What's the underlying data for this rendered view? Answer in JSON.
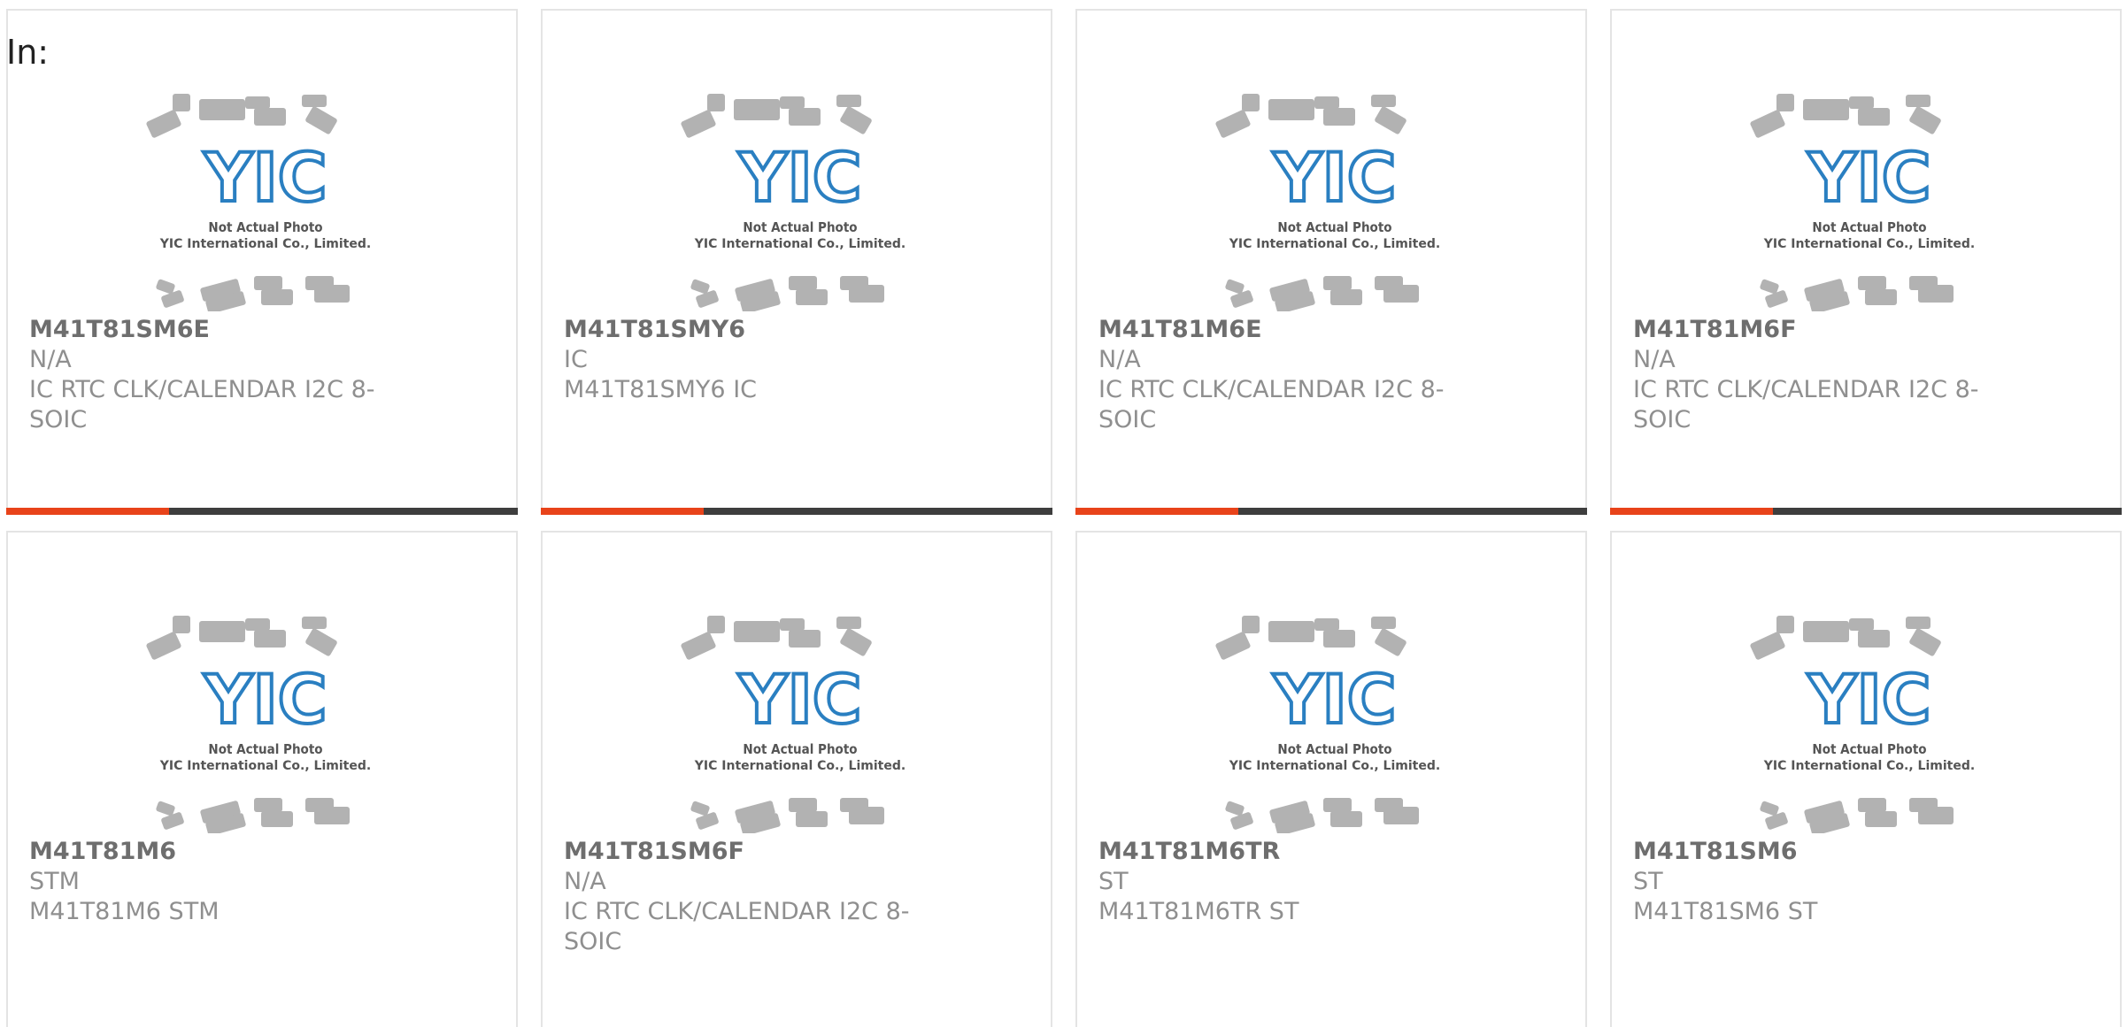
{
  "header": {
    "label": "In:"
  },
  "colors": {
    "accent": "#e8431a",
    "bar_dark": "#3e3e3e",
    "logo_blue": "#2a7fc1",
    "chip_gray": "#b2b2b2"
  },
  "placeholder": {
    "line1": "Not Actual Photo",
    "line2": "YIC International Co., Limited.",
    "logo": "YIC"
  },
  "products": [
    {
      "part": "M41T81SM6E",
      "brand": "N/A",
      "desc": "IC RTC CLK/CALENDAR I2C 8-SOIC"
    },
    {
      "part": "M41T81SMY6",
      "brand": "IC",
      "desc": "M41T81SMY6 IC"
    },
    {
      "part": "M41T81M6E",
      "brand": "N/A",
      "desc": "IC RTC CLK/CALENDAR I2C 8-SOIC"
    },
    {
      "part": "M41T81M6F",
      "brand": "N/A",
      "desc": "IC RTC CLK/CALENDAR I2C 8-SOIC"
    },
    {
      "part": "M41T81M6",
      "brand": "STM",
      "desc": "M41T81M6 STM"
    },
    {
      "part": "M41T81SM6F",
      "brand": "N/A",
      "desc": "IC RTC CLK/CALENDAR I2C 8-SOIC"
    },
    {
      "part": "M41T81M6TR",
      "brand": "ST",
      "desc": "M41T81M6TR ST"
    },
    {
      "part": "M41T81SM6",
      "brand": "ST",
      "desc": "M41T81SM6 ST"
    }
  ]
}
